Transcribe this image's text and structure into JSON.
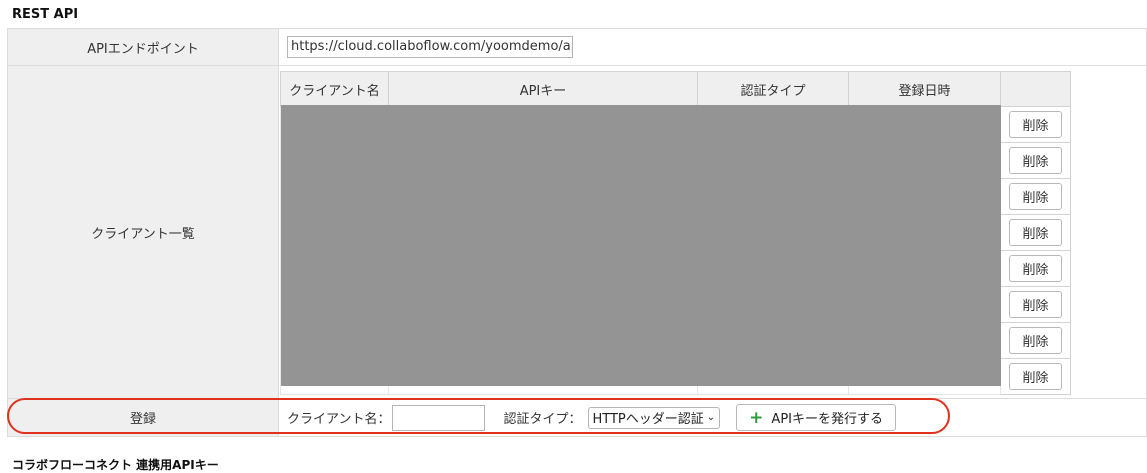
{
  "section_title": "REST API",
  "bottom_section_title": "コラボフローコネクト 連携用APIキー",
  "endpoint": {
    "label": "APIエンドポイント",
    "value": "https://cloud.collaboflow.com/yoomdemo/api"
  },
  "clients": {
    "label": "クライアント一覧",
    "columns": [
      "クライアント名",
      "APIキー",
      "認証タイプ",
      "登録日時"
    ],
    "delete_label": "削除",
    "row_count": 8
  },
  "register": {
    "label": "登録",
    "client_name_label": "クライアント名：",
    "client_name_value": "",
    "auth_type_label": "認証タイプ：",
    "auth_type_selected": "HTTPヘッダー認証",
    "issue_button": "APIキーを発行する"
  },
  "colors": {
    "highlight": "#e0301e",
    "plus_icon": "#2e9d3a",
    "redaction": "#949494"
  }
}
